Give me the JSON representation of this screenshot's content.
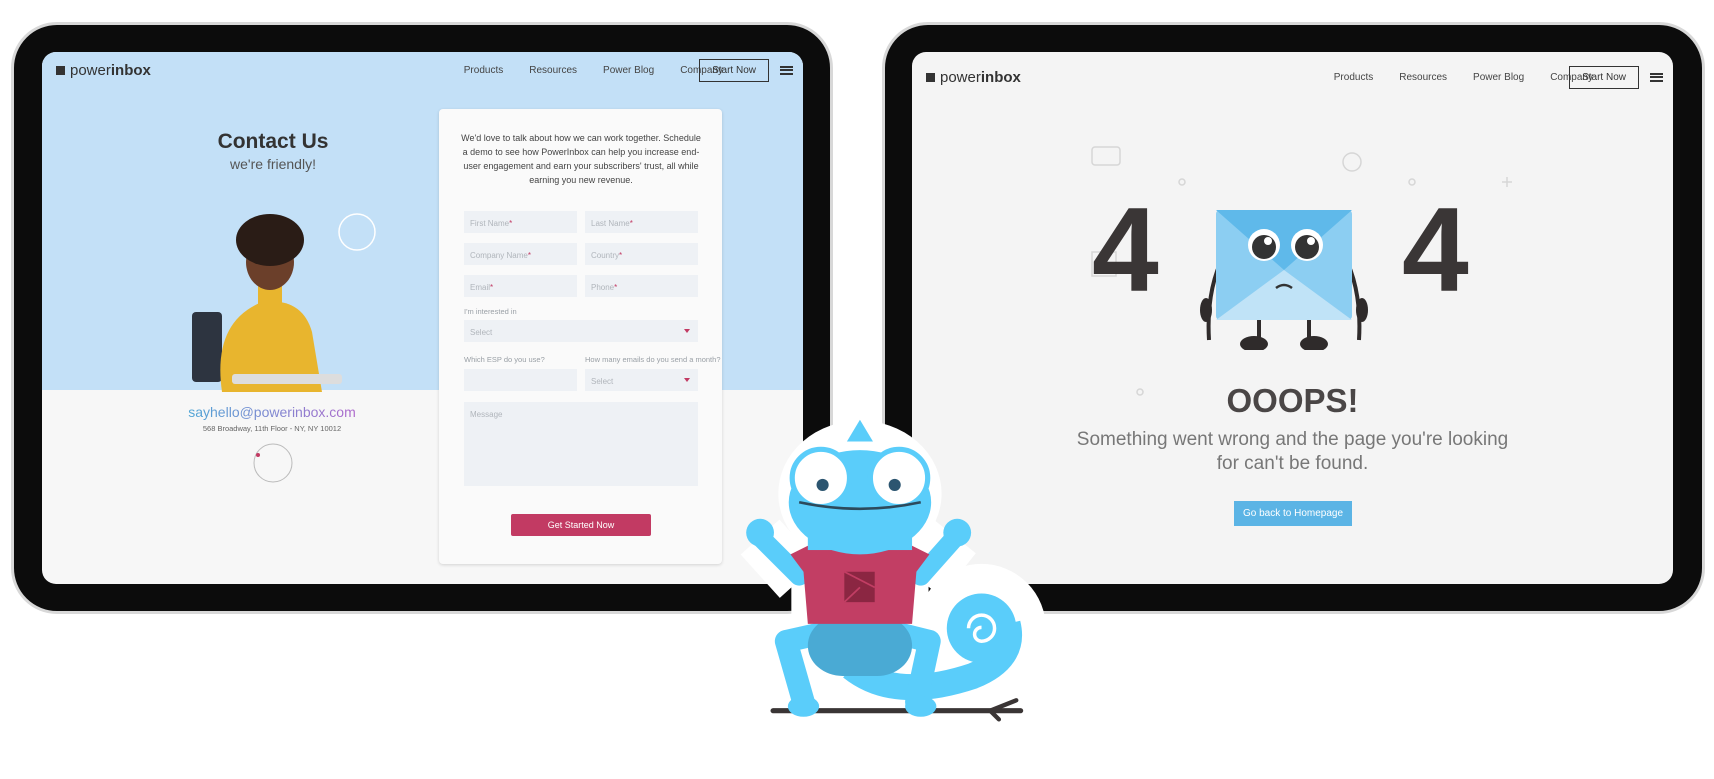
{
  "nav": {
    "logo_light": "power",
    "logo_bold": "inbox",
    "links": [
      "Products",
      "Resources",
      "Power Blog",
      "Company"
    ],
    "cta": "Start Now"
  },
  "contact": {
    "title": "Contact Us",
    "subtitle": "we're friendly!",
    "intro": "We'd love to talk about how we can work together. Schedule a demo to see how PowerInbox can help you increase end-user engagement and earn your subscribers' trust, all while earning you new revenue.",
    "fields": {
      "first_name": "First Name",
      "last_name": "Last Name",
      "company": "Company Name",
      "country": "Country",
      "email": "Email",
      "phone": "Phone",
      "required_mark": "*",
      "interest_label": "I'm interested in",
      "interest_value": "Select",
      "esp_label": "Which ESP do you use?",
      "emails_label": "How many emails do you send a month?",
      "emails_value": "Select",
      "message_placeholder": "Message"
    },
    "submit": "Get Started Now",
    "email": "sayhello@powerinbox.com",
    "address": "568 Broadway, 11th Floor - NY, NY 10012"
  },
  "error": {
    "digit_left": "4",
    "digit_right": "4",
    "heading": "OOOPS!",
    "line1": "Something went wrong and the page you're looking",
    "line2": "for can't be found.",
    "button": "Go back to Homepage"
  },
  "colors": {
    "accent_pink": "#c23a63",
    "sky_blue": "#c3e0f7",
    "button_blue": "#5bb4e5",
    "chameleon": "#5acdfa",
    "shirt": "#c23e64"
  }
}
